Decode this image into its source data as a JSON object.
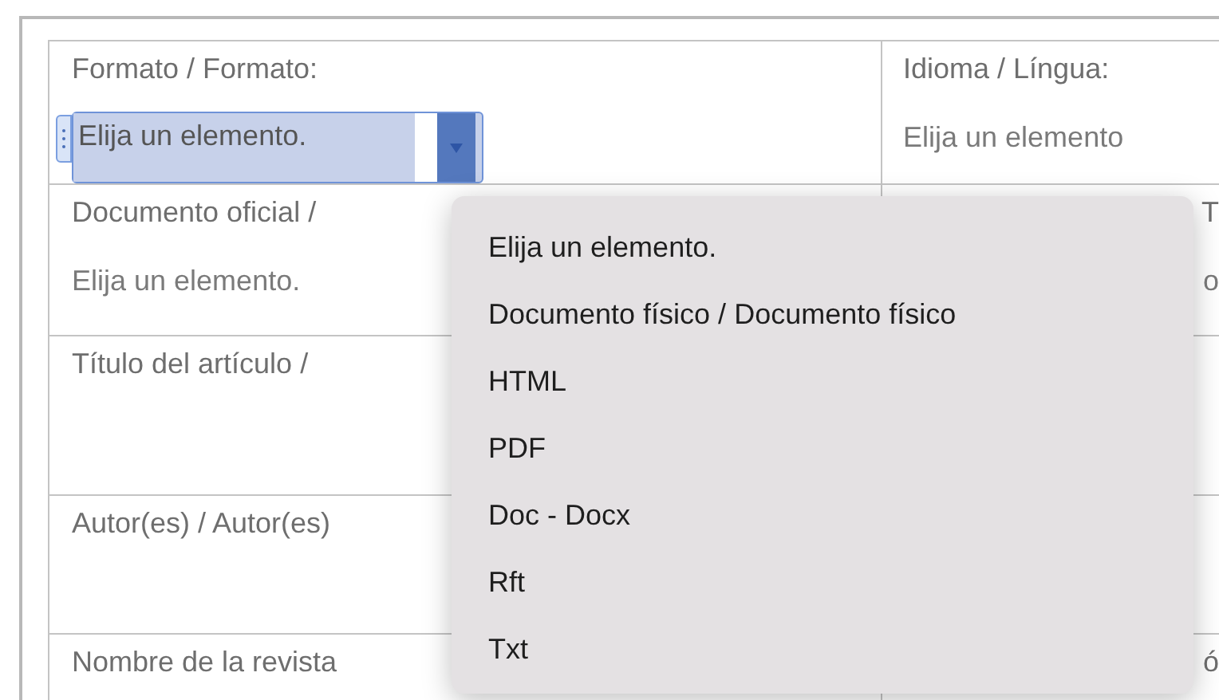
{
  "rows": [
    {
      "left": {
        "label": "Formato / Formato:",
        "dropdown": {
          "value": "Elija un elemento.",
          "open": true,
          "options": [
            "Elija un elemento.",
            "Documento físico / Documento físico",
            "HTML",
            "PDF",
            "Doc - Docx",
            "Rft",
            "Txt"
          ]
        }
      },
      "right": {
        "label": "Idioma / Língua:",
        "value": "Elija un elemento"
      }
    },
    {
      "left": {
        "label": "Documento oficial /",
        "value": "Elija un elemento."
      },
      "right": {
        "label": "T",
        "value": "o"
      }
    },
    {
      "left": {
        "label": "Título del artículo /"
      },
      "right": {}
    },
    {
      "left": {
        "label": "Autor(es) / Autor(es)"
      },
      "right": {}
    },
    {
      "left": {
        "label": "Nombre de la revista"
      },
      "right": {
        "label": "ó"
      }
    }
  ]
}
